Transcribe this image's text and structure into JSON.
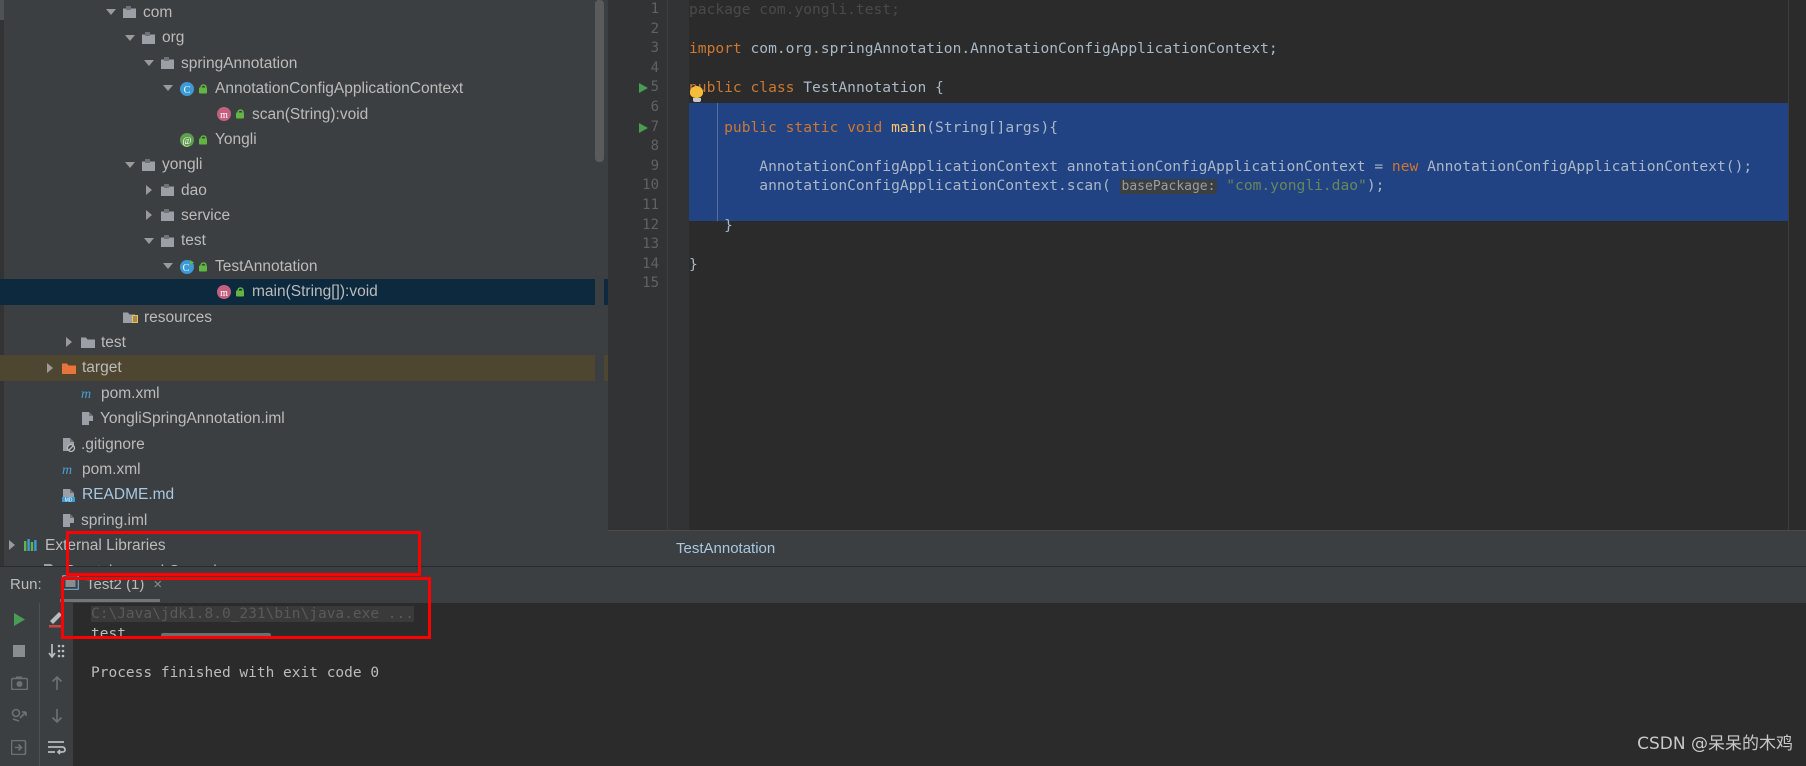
{
  "tree": {
    "items": [
      {
        "label": "com",
        "indent": 106,
        "arrow": "down",
        "icon": "package-icon",
        "selected": false,
        "highlight": false
      },
      {
        "label": "org",
        "indent": 125,
        "arrow": "down",
        "icon": "package-icon",
        "selected": false,
        "highlight": false
      },
      {
        "label": "springAnnotation",
        "indent": 144,
        "arrow": "down",
        "icon": "package-icon",
        "selected": false,
        "highlight": false
      },
      {
        "label": "AnnotationConfigApplicationContext",
        "indent": 163,
        "arrow": "down",
        "icon": "class-icon",
        "selected": false,
        "highlight": false
      },
      {
        "label": "scan(String):void",
        "indent": 200,
        "arrow": "none",
        "icon": "method-icon",
        "selected": false,
        "highlight": false
      },
      {
        "label": "Yongli",
        "indent": 163,
        "arrow": "none",
        "icon": "annotation-icon",
        "selected": false,
        "highlight": false
      },
      {
        "label": "yongli",
        "indent": 125,
        "arrow": "down",
        "icon": "package-icon",
        "selected": false,
        "highlight": false
      },
      {
        "label": "dao",
        "indent": 144,
        "arrow": "right",
        "icon": "package-icon",
        "selected": false,
        "highlight": false
      },
      {
        "label": "service",
        "indent": 144,
        "arrow": "right",
        "icon": "package-icon",
        "selected": false,
        "highlight": false
      },
      {
        "label": "test",
        "indent": 144,
        "arrow": "down",
        "icon": "package-icon",
        "selected": false,
        "highlight": false
      },
      {
        "label": "TestAnnotation",
        "indent": 163,
        "arrow": "down",
        "icon": "class-run-icon",
        "selected": false,
        "highlight": false
      },
      {
        "label": "main(String[]):void",
        "indent": 200,
        "arrow": "none",
        "icon": "method-icon",
        "selected": true,
        "highlight": false
      },
      {
        "label": "resources",
        "indent": 106,
        "arrow": "none",
        "icon": "resources-icon",
        "selected": false,
        "highlight": false
      },
      {
        "label": "test",
        "indent": 64,
        "arrow": "right",
        "icon": "folder-icon",
        "selected": false,
        "highlight": false
      },
      {
        "label": "target",
        "indent": 45,
        "arrow": "right",
        "icon": "folder-orange-icon",
        "selected": false,
        "highlight": true
      },
      {
        "label": "pom.xml",
        "indent": 64,
        "arrow": "none",
        "icon": "maven-icon",
        "selected": false,
        "highlight": false
      },
      {
        "label": "YongliSpringAnnotation.iml",
        "indent": 64,
        "arrow": "none",
        "icon": "iml-icon",
        "selected": false,
        "highlight": false
      },
      {
        "label": ".gitignore",
        "indent": 45,
        "arrow": "none",
        "icon": "gitignore-icon",
        "selected": false,
        "highlight": false
      },
      {
        "label": "pom.xml",
        "indent": 45,
        "arrow": "none",
        "icon": "maven-icon",
        "selected": false,
        "highlight": false
      },
      {
        "label": "README.md",
        "indent": 45,
        "arrow": "none",
        "icon": "markdown-icon",
        "selected": false,
        "highlight": false,
        "blue": true
      },
      {
        "label": "spring.iml",
        "indent": 45,
        "arrow": "none",
        "icon": "iml-icon",
        "selected": false,
        "highlight": false
      },
      {
        "label": "External Libraries",
        "indent": 7,
        "arrow": "right",
        "icon": "libraries-icon",
        "selected": false,
        "highlight": false
      },
      {
        "label": "Scratches and Consoles",
        "indent": 26,
        "arrow": "none",
        "icon": "scratches-icon",
        "selected": false,
        "highlight": false
      }
    ]
  },
  "editor": {
    "line_numbers": [
      "1",
      "2",
      "3",
      "4",
      "5",
      "6",
      "7",
      "8",
      "9",
      "10",
      "11",
      "12",
      "13",
      "14",
      "15"
    ],
    "lines": [
      {
        "n": 1,
        "segments": [
          {
            "t": "package com.yongli.test;",
            "c": "fadeline"
          }
        ]
      },
      {
        "n": 3,
        "segments": [
          {
            "t": "import ",
            "c": "kw"
          },
          {
            "t": "com.org.springAnnotation.AnnotationConfigApplicationContext;",
            "c": "cls"
          }
        ]
      },
      {
        "n": 5,
        "segments": [
          {
            "t": "public class ",
            "c": "kw"
          },
          {
            "t": "TestAnnotation {",
            "c": "cls"
          }
        ]
      },
      {
        "n": 7,
        "segments": [
          {
            "t": "    public static void ",
            "c": "kw"
          },
          {
            "t": "main",
            "c": "mth"
          },
          {
            "t": "(String[]args){",
            "c": "cls"
          }
        ]
      },
      {
        "n": 9,
        "segments": [
          {
            "t": "        AnnotationConfigApplicationContext annotationConfigApplicationContext = ",
            "c": "cls"
          },
          {
            "t": "new ",
            "c": "kw"
          },
          {
            "t": "AnnotationConfigApplicationContext();",
            "c": "cls"
          }
        ]
      },
      {
        "n": 10,
        "segments": [
          {
            "t": "        annotationConfigApplicationContext.scan( ",
            "c": "cls"
          },
          {
            "t": "basePackage:",
            "c": "hint"
          },
          {
            "t": " ",
            "c": "cls"
          },
          {
            "t": "\"com.yongli.dao\"",
            "c": "str"
          },
          {
            "t": ");",
            "c": "cls"
          }
        ]
      },
      {
        "n": 12,
        "segments": [
          {
            "t": "    }",
            "c": "cls"
          }
        ]
      },
      {
        "n": 14,
        "segments": [
          {
            "t": "}",
            "c": "cls"
          }
        ]
      }
    ],
    "run_marker_lines": [
      5,
      7
    ],
    "fold_markers": [
      {
        "line": 7,
        "glyph": "⌐"
      },
      {
        "line": 12,
        "glyph": "⌐"
      }
    ],
    "breadcrumb": "TestAnnotation"
  },
  "run_tool": {
    "run_label": "Run:",
    "tab_label": "Test2 (1)",
    "close_glyph": "×",
    "toolbar_left": [
      "run-icon",
      "stop-icon",
      "camera-icon",
      "restore-layout-icon",
      "export-icon"
    ],
    "toolbar_second": [
      "edit-config-icon",
      "sort-icon",
      "up-arrow-icon",
      "down-arrow-icon",
      "wrap-icon"
    ],
    "console": [
      {
        "text": "C:\\Java\\jdk1.8.0_231\\bin\\java.exe ...",
        "dim": true
      },
      {
        "text": "test",
        "dim": false
      },
      {
        "text": "Process finished with exit code 0",
        "dim": false
      }
    ]
  },
  "annotations": {
    "box_color": "#fe0000",
    "box_count": 2
  },
  "watermark": {
    "text": "CSDN @呆呆的木鸡"
  },
  "colors": {
    "bg_panel": "#3c3f41",
    "bg_editor": "#2b2b2b",
    "selection": "#214283",
    "tree_selected": "#0d293e",
    "tree_highlight": "#4e4631",
    "keyword": "#cc7832",
    "string": "#6a8759",
    "method": "#ffc66d",
    "text": "#a9b7c6",
    "annotation_red": "#fe0000"
  }
}
